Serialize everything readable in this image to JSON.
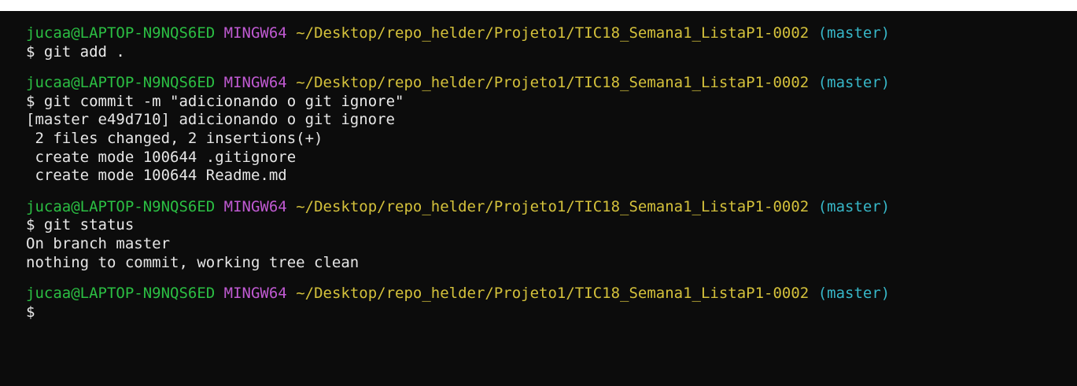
{
  "prompt": {
    "user_host": "jucaa@LAPTOP-N9NQS6ED",
    "system": "MINGW64",
    "path": "~/Desktop/repo_helder/Projeto1/TIC18_Semana1_ListaP1-0002",
    "branch": "(master)",
    "symbol": "$"
  },
  "session": [
    {
      "command": "git add .",
      "output": []
    },
    {
      "command": "git commit -m \"adicionando o git ignore\"",
      "output": [
        "[master e49d710] adicionando o git ignore",
        " 2 files changed, 2 insertions(+)",
        " create mode 100644 .gitignore",
        " create mode 100644 Readme.md"
      ]
    },
    {
      "command": "git status",
      "output": [
        "On branch master",
        "nothing to commit, working tree clean"
      ]
    },
    {
      "command": "",
      "output": []
    }
  ]
}
